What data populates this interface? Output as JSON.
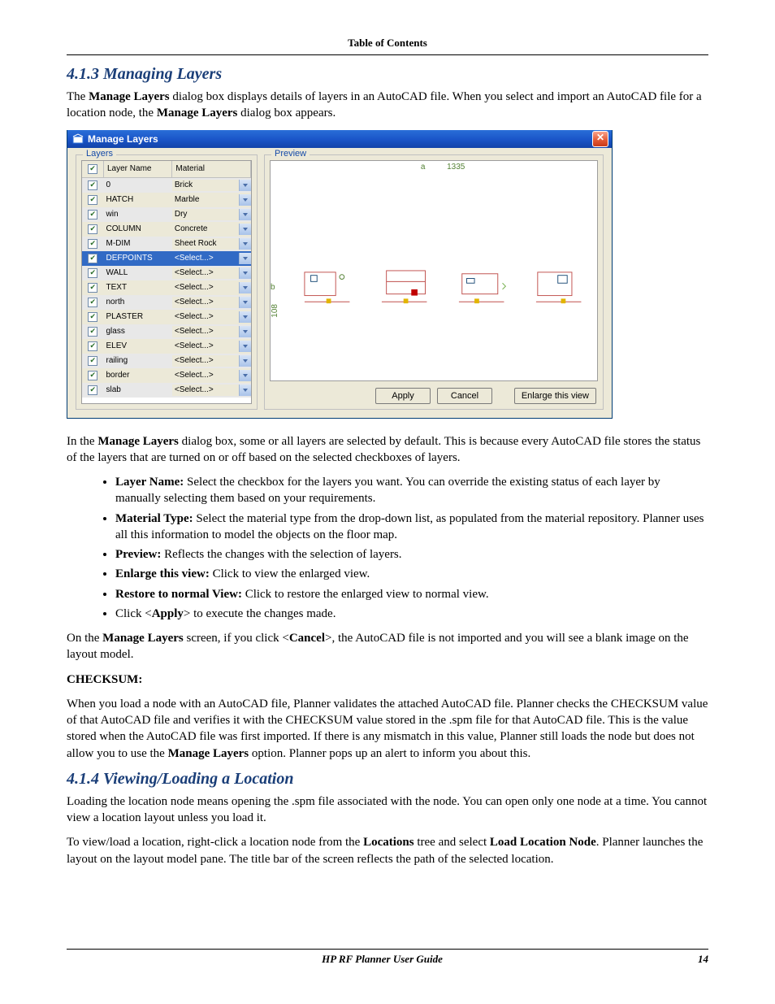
{
  "header": {
    "toc": "Table of Contents"
  },
  "s413": {
    "title": "4.1.3   Managing Layers",
    "p1a": "The ",
    "p1b": "Manage Layers",
    "p1c": " dialog box displays details of layers in an AutoCAD file. When you select and import an AutoCAD file for a location node, the ",
    "p1d": "Manage Layers",
    "p1e": " dialog box appears."
  },
  "dialog": {
    "title": "Manage Layers",
    "close_glyph": "✕",
    "layers_legend": "Layers",
    "preview_legend": "Preview",
    "col_check_glyph": "✔",
    "col_name": "Layer Name",
    "col_material": "Material",
    "preview_a": "a",
    "preview_n": "1335",
    "preview_b": "b",
    "preview_m": "108",
    "rows": [
      {
        "name": "0",
        "material": "Brick",
        "alt": false
      },
      {
        "name": "HATCH",
        "material": "Marble",
        "alt": true
      },
      {
        "name": "win",
        "material": "Dry",
        "alt": false
      },
      {
        "name": "COLUMN",
        "material": "Concrete",
        "alt": true
      },
      {
        "name": "M-DIM",
        "material": "Sheet Rock",
        "alt": false
      },
      {
        "name": "DEFPOINTS",
        "material": "<Select...>",
        "alt": true,
        "sel": true
      },
      {
        "name": "WALL",
        "material": "<Select...>",
        "alt": false
      },
      {
        "name": "TEXT",
        "material": "<Select...>",
        "alt": true
      },
      {
        "name": "north",
        "material": "<Select...>",
        "alt": false
      },
      {
        "name": "PLASTER",
        "material": "<Select...>",
        "alt": true
      },
      {
        "name": "glass",
        "material": "<Select...>",
        "alt": false
      },
      {
        "name": "ELEV",
        "material": "<Select...>",
        "alt": true
      },
      {
        "name": "railing",
        "material": "<Select...>",
        "alt": false
      },
      {
        "name": "border",
        "material": "<Select...>",
        "alt": true
      },
      {
        "name": "slab",
        "material": "<Select...>",
        "alt": false
      }
    ],
    "buttons": {
      "apply": "Apply",
      "cancel": "Cancel",
      "enlarge": "Enlarge this view"
    }
  },
  "after": {
    "p2a": "In the ",
    "p2b": "Manage Layers",
    "p2c": " dialog box, some or all layers are selected by default. This is because every AutoCAD file stores the status of the layers that are turned on or off based on the selected checkboxes of layers.",
    "bul1a": "Layer Name:",
    "bul1b": " Select the checkbox for the layers you want. You can override the existing status of each layer by manually selecting them based on your requirements.",
    "bul2a": "Material Type:",
    "bul2b": " Select the material type from the drop-down list, as populated from the material repository. Planner uses all this information to model the objects on the floor map.",
    "bul3a": "Preview:",
    "bul3b": " Reflects the changes with the selection of layers.",
    "bul4a": "Enlarge this view:",
    "bul4b": " Click to view the enlarged view.",
    "bul5a": "Restore to normal View:",
    "bul5b": " Click to restore the enlarged view to normal view.",
    "bul6a": "Click <",
    "bul6b": "Apply",
    "bul6c": "> to execute the changes made.",
    "p3a": "On the ",
    "p3b": "Manage Layers",
    "p3c": " screen, if you click <",
    "p3d": "Cancel",
    "p3e": ">, the AutoCAD file is not imported and you will see a blank image on the layout model.",
    "checksum_h": "CHECKSUM:",
    "p4a": "When you load a node with an AutoCAD file, Planner validates the attached AutoCAD file. Planner checks the CHECKSUM value of that AutoCAD file and verifies it with the CHECKSUM value stored in the .spm file for that AutoCAD file. This is the value stored when the AutoCAD file was first imported. If there is any mismatch in this value, Planner still loads the node but does not allow you to use the ",
    "p4b": "Manage Layers",
    "p4c": " option. Planner pops up an alert to inform you about this."
  },
  "s414": {
    "title": "4.1.4   Viewing/Loading a Location",
    "p1": "Loading the location node means opening the .spm file associated with the node. You can open only one node at a time. You cannot view a location layout unless you load it.",
    "p2a": "To view/load a location, right-click a location node from the ",
    "p2b": "Locations",
    "p2c": " tree and select ",
    "p2d": "Load Location Node",
    "p2e": ". Planner launches the layout on the layout model pane. The title bar of the screen reflects the path of the selected location."
  },
  "footer": {
    "guide": "HP RF Planner User Guide",
    "page": "14"
  }
}
